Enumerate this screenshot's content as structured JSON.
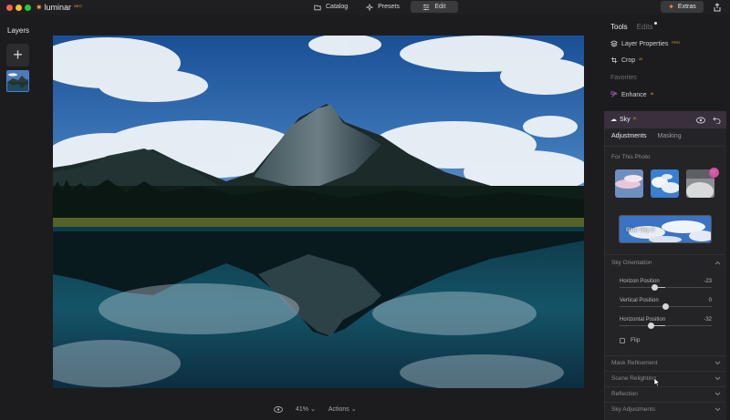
{
  "app": {
    "logo_text": "luminar",
    "logo_badge": "NEO"
  },
  "modes": [
    {
      "label": "Catalog",
      "icon": "folder-icon",
      "active": false
    },
    {
      "label": "Presets",
      "icon": "sparkle-icon",
      "active": false
    },
    {
      "label": "Edit",
      "icon": "sliders-icon",
      "active": true
    }
  ],
  "extras": {
    "label": "Extras",
    "icon": "extras-icon"
  },
  "layers": {
    "title": "Layers",
    "add_symbol": "+"
  },
  "bottom": {
    "zoom": "41%",
    "actions": "Actions"
  },
  "right_panel": {
    "tabs": {
      "tools": "Tools",
      "edits": "Edits"
    },
    "tools": [
      {
        "label": "Layer Properties",
        "tag": "PRO",
        "icon": "layers-icon"
      },
      {
        "label": "Crop",
        "tag": "AI",
        "icon": "crop-icon"
      }
    ],
    "favorites_label": "Favorites",
    "favorites": [
      {
        "label": "Enhance",
        "tag": "AI",
        "icon": "enhance-icon"
      }
    ],
    "sky": {
      "title": "Sky",
      "tag": "AI",
      "subtabs": {
        "adjustments": "Adjustments",
        "masking": "Masking"
      },
      "for_this_photo": "For This Photo",
      "selected_sky": "Blue Sky 3",
      "orientation_label": "Sky Orientation",
      "sliders": [
        {
          "label": "Horizon Position",
          "value": "-23",
          "numeric": -23
        },
        {
          "label": "Vertical Position",
          "value": "0",
          "numeric": 0
        },
        {
          "label": "Horizontal Position",
          "value": "-32",
          "numeric": -32
        }
      ],
      "flip_label": "Flip",
      "flip_checked": false,
      "sections": [
        "Mask Refinement",
        "Scene Relighting",
        "Reflection",
        "Sky Adjustments"
      ]
    }
  },
  "colors": {
    "accent_pink": "#e04aa0",
    "sky_header": "#3a2f3d",
    "selection_blue": "#4e7fd6"
  }
}
